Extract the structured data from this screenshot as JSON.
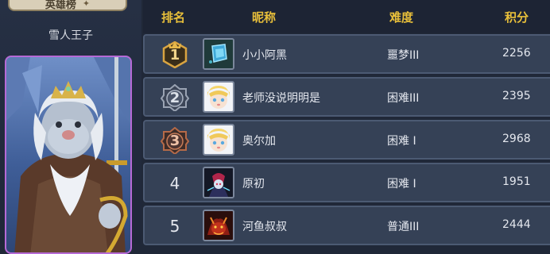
{
  "hero_panel": {
    "tab_title": "英雄榜",
    "hero_name": "雪人王子"
  },
  "header": {
    "rank": "排名",
    "nickname": "昵称",
    "difficulty": "难度",
    "score": "积分"
  },
  "rows": [
    {
      "rank": "1",
      "rank_style": "gold-badge",
      "avatar": "cube-avatar-icon",
      "nickname": "小小阿黑",
      "difficulty": "噩梦III",
      "score": "2256"
    },
    {
      "rank": "2",
      "rank_style": "silver-badge",
      "avatar": "snow-girl-avatar-icon",
      "nickname": "老师没说明明是",
      "difficulty": "困难III",
      "score": "2395"
    },
    {
      "rank": "3",
      "rank_style": "bronze-badge",
      "avatar": "snow-girl-avatar-icon",
      "nickname": "奥尔加",
      "difficulty": "困难 I",
      "score": "2968"
    },
    {
      "rank": "4",
      "rank_style": "plain",
      "avatar": "dark-mage-avatar-icon",
      "nickname": "原初",
      "difficulty": "困难 I",
      "score": "1951"
    },
    {
      "rank": "5",
      "rank_style": "plain",
      "avatar": "fire-demon-avatar-icon",
      "nickname": "河鱼叔叔",
      "difficulty": "普通III",
      "score": "2444"
    }
  ],
  "colors": {
    "header_text": "#e8bf3a",
    "row_bg": "#354156",
    "portrait_border": "#b66ad6",
    "gold": "#d9a441",
    "silver": "#9aa3b3",
    "bronze": "#b56a48"
  }
}
